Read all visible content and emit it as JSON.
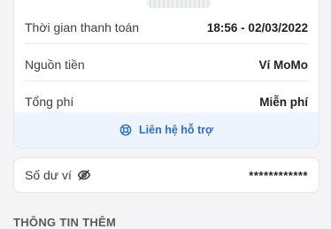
{
  "details": {
    "rows": [
      {
        "label": "Thời gian thanh toán",
        "value": "18:56 - 02/03/2022"
      },
      {
        "label": "Nguồn tiền",
        "value": "Ví MoMo"
      },
      {
        "label": "Tổng phí",
        "value": "Miễn phí"
      }
    ],
    "support_label": "Liên hệ hỗ trợ"
  },
  "balance": {
    "label": "Số dư ví",
    "value": "************"
  },
  "section": {
    "title": "THÔNG TIN THÊM"
  },
  "colors": {
    "accent": "#2b6fc8",
    "support_bg": "#eef4fd"
  },
  "icons": {
    "support": "lifebuoy-icon",
    "balance": "eye-off-icon"
  }
}
